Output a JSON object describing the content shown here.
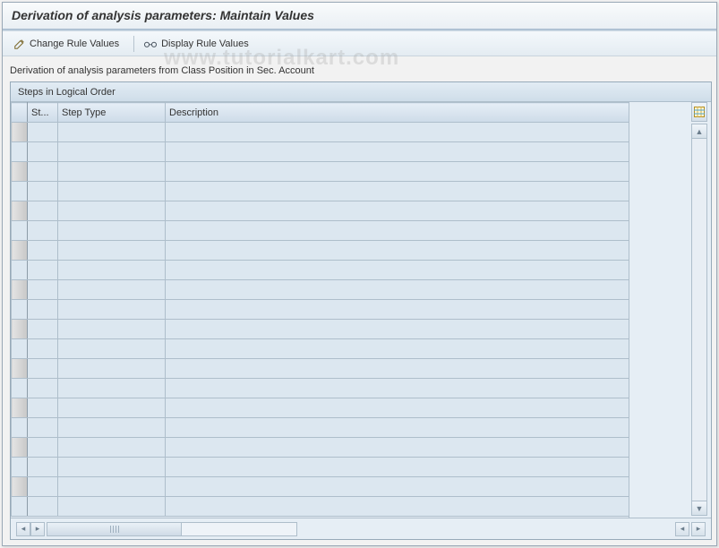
{
  "title": "Derivation of analysis parameters: Maintain Values",
  "toolbar": {
    "change_label": "Change Rule Values",
    "display_label": "Display Rule Values"
  },
  "subtitle": "Derivation of analysis parameters from Class Position in Sec. Account",
  "panel": {
    "heading": "Steps in Logical Order",
    "columns": {
      "st": "St...",
      "type": "Step Type",
      "desc": "Description"
    },
    "rows": [
      {
        "st": "",
        "type": "",
        "desc": ""
      },
      {
        "st": "",
        "type": "",
        "desc": ""
      },
      {
        "st": "",
        "type": "",
        "desc": ""
      },
      {
        "st": "",
        "type": "",
        "desc": ""
      },
      {
        "st": "",
        "type": "",
        "desc": ""
      },
      {
        "st": "",
        "type": "",
        "desc": ""
      },
      {
        "st": "",
        "type": "",
        "desc": ""
      },
      {
        "st": "",
        "type": "",
        "desc": ""
      },
      {
        "st": "",
        "type": "",
        "desc": ""
      },
      {
        "st": "",
        "type": "",
        "desc": ""
      },
      {
        "st": "",
        "type": "",
        "desc": ""
      },
      {
        "st": "",
        "type": "",
        "desc": ""
      },
      {
        "st": "",
        "type": "",
        "desc": ""
      },
      {
        "st": "",
        "type": "",
        "desc": ""
      },
      {
        "st": "",
        "type": "",
        "desc": ""
      },
      {
        "st": "",
        "type": "",
        "desc": ""
      },
      {
        "st": "",
        "type": "",
        "desc": ""
      },
      {
        "st": "",
        "type": "",
        "desc": ""
      },
      {
        "st": "",
        "type": "",
        "desc": ""
      },
      {
        "st": "",
        "type": "",
        "desc": ""
      }
    ]
  },
  "watermark": "www.tutorialkart.com"
}
